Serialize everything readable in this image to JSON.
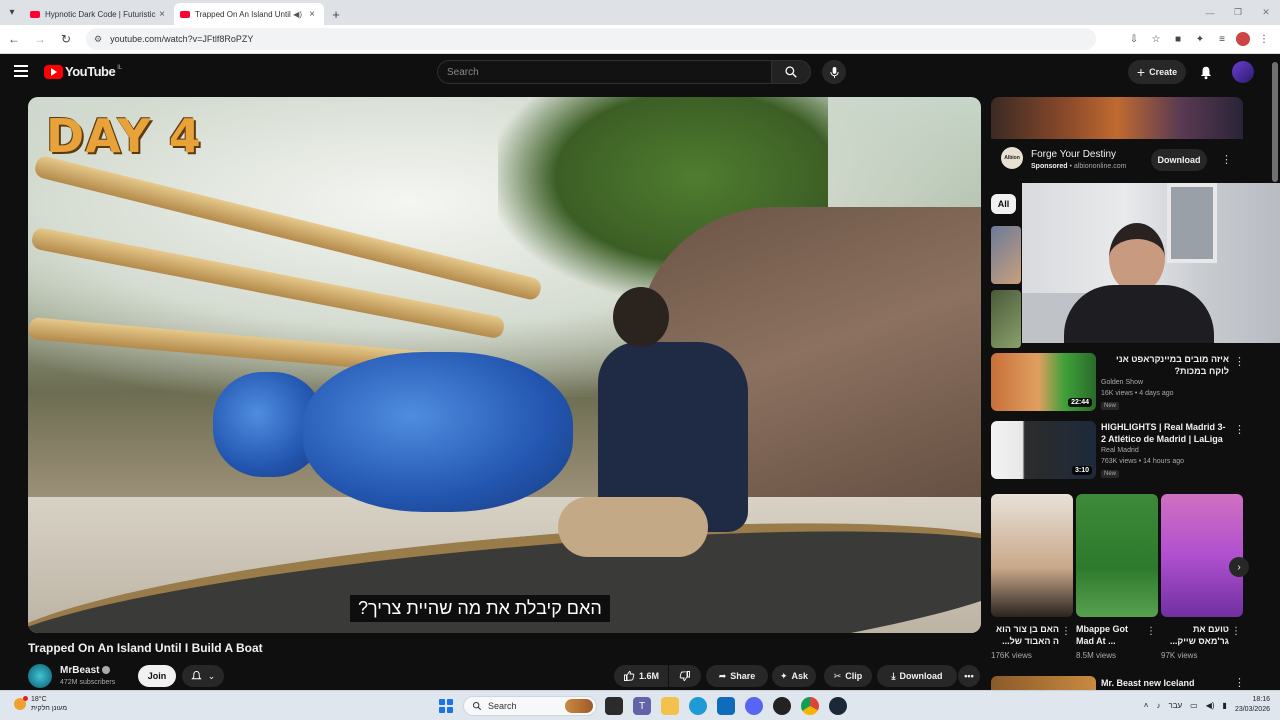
{
  "browser": {
    "tabs": [
      {
        "title": "Hypnotic Dark Code | Futuristic"
      },
      {
        "title": "Trapped On An Island Until I"
      }
    ],
    "url": "youtube.com/watch?v=JFtlf8RoPZY"
  },
  "header": {
    "logo_text": "YouTube",
    "logo_country": "IL",
    "search_placeholder": "Search",
    "create_label": "Create"
  },
  "player": {
    "overlay_text": "DAY 4",
    "caption": "האם קיבלת את מה שהיית צריך?"
  },
  "video": {
    "title": "Trapped On An Island Until I Build A Boat",
    "channel": "MrBeast",
    "subscribers": "472M subscribers",
    "join_label": "Join",
    "like_count": "1.6M",
    "share_label": "Share",
    "ask_label": "Ask",
    "clip_label": "Clip",
    "download_label": "Download"
  },
  "ad": {
    "logo_text": "Albion",
    "title": "Forge Your Destiny",
    "sponsored": "Sponsored",
    "domain": "albiononline.com",
    "button": "Download"
  },
  "filters": {
    "all": "All"
  },
  "recommendations": [
    {
      "title": "איזה מובים במיינקראפט אני לוקח במכות?",
      "channel": "Golden Show",
      "meta": "16K views • 4 days ago",
      "badge": "New",
      "duration": "22:44"
    },
    {
      "title": "HIGHLIGHTS | Real Madrid 3-2 Atlético de Madrid | LaLiga",
      "channel": "Real Madrid",
      "meta": "763K views • 14 hours ago",
      "badge": "New",
      "duration": "3:10"
    }
  ],
  "shorts": [
    {
      "title": "האם בן צור הוא ה האבוד של...",
      "views": "176K views"
    },
    {
      "title": "Mbappe Got Mad At ...",
      "views": "8.5M views"
    },
    {
      "title": "טועם את גר'מאס שייק...",
      "views": "97K views"
    }
  ],
  "next_rec": {
    "title": "Mr. Beast new Iceland"
  },
  "taskbar": {
    "temperature": "18°C",
    "weather_desc": "מעונן חלקית",
    "search_label": "Search",
    "lang": "עבר",
    "time": "18:16",
    "date": "23/03/2026"
  },
  "colors": {
    "yt_red": "#ff0000",
    "bg": "#0f0f0f",
    "chip": "#272727"
  }
}
